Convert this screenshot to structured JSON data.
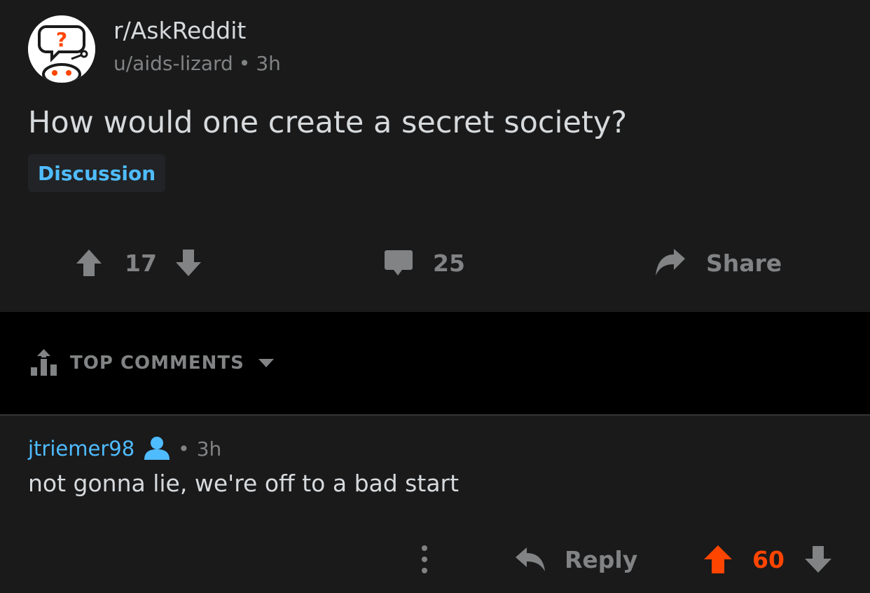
{
  "post": {
    "subreddit": "r/AskReddit",
    "author": "u/aids-lizard",
    "separator": "•",
    "age": "3h",
    "title": "How would one create a secret society?",
    "flair": "Discussion",
    "upvotes": "17",
    "comments": "25",
    "share_label": "Share"
  },
  "sort": {
    "label": "TOP COMMENTS",
    "icon": "sort-bars-icon"
  },
  "comment": {
    "username": "jtriemer98",
    "user_icon": "user-icon",
    "separator": "•",
    "age": "3h",
    "body": "not gonna lie, we're off to a bad start",
    "more_icon": "vertical-dots-icon",
    "reply_label": "Reply",
    "score": "60"
  },
  "colors": {
    "background": "#1a1a1b",
    "sort_background": "#000000",
    "text_primary": "#d7dadc",
    "text_muted": "#818384",
    "link_blue": "#4fbcff",
    "upvote_orange": "#ff4500"
  }
}
